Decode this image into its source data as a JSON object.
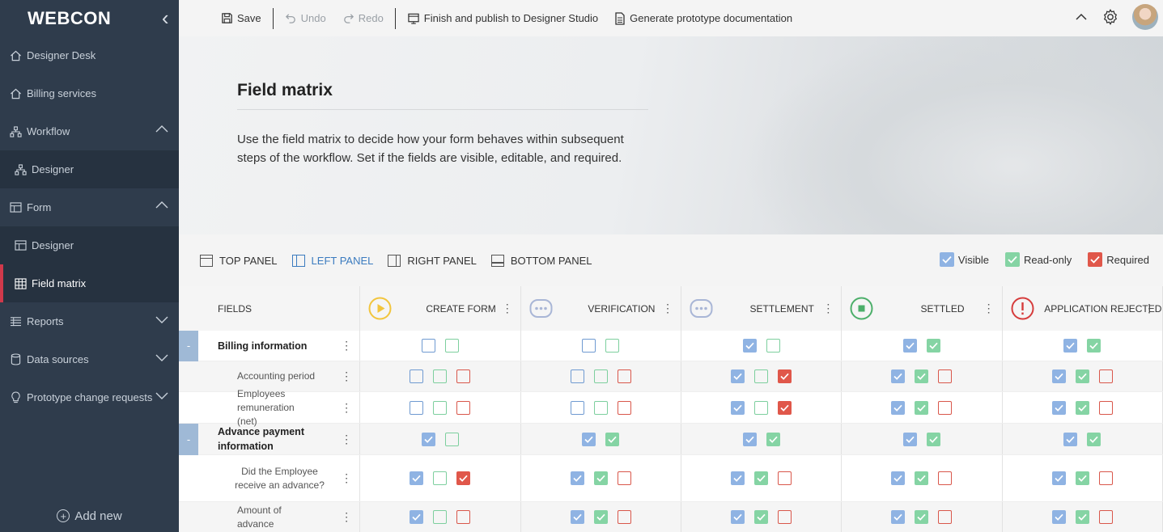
{
  "app": {
    "logo": "WEBCON"
  },
  "sidebar": {
    "items": [
      {
        "label": "Designer Desk",
        "icon": "home-icon"
      },
      {
        "label": "Billing services",
        "icon": "home-icon"
      },
      {
        "label": "Workflow",
        "icon": "workflow-icon",
        "expanded": true
      },
      {
        "label": "Designer",
        "icon": "workflow-icon",
        "sub": true
      },
      {
        "label": "Form",
        "icon": "form-icon",
        "expanded": true
      },
      {
        "label": "Designer",
        "icon": "form-icon",
        "sub": true
      },
      {
        "label": "Field matrix",
        "icon": "matrix-icon",
        "sub": true,
        "active": true
      },
      {
        "label": "Reports",
        "icon": "list-icon",
        "expanded": false
      },
      {
        "label": "Data sources",
        "icon": "database-icon",
        "expanded": false
      },
      {
        "label": "Prototype change requests",
        "icon": "lightbulb-icon",
        "expanded": false
      }
    ],
    "add_new": "Add new"
  },
  "toolbar": {
    "save": "Save",
    "undo": "Undo",
    "redo": "Redo",
    "finish": "Finish and publish to Designer Studio",
    "generate": "Generate prototype documentation"
  },
  "hero": {
    "title": "Field matrix",
    "description": "Use the field matrix to decide how your form behaves within subsequent steps of the workflow. Set if the fields are visible, editable, and required."
  },
  "panels": {
    "tabs": [
      {
        "label": "TOP PANEL",
        "active": false
      },
      {
        "label": "LEFT PANEL",
        "active": true
      },
      {
        "label": "RIGHT PANEL",
        "active": false
      },
      {
        "label": "BOTTOM PANEL",
        "active": false
      }
    ],
    "legend": {
      "visible": "Visible",
      "readonly": "Read-only",
      "required": "Required"
    }
  },
  "colors": {
    "visible": "#8fb3e3",
    "readonly": "#85d4a4",
    "required": "#e0574a",
    "start": "#f2c53d",
    "intermediate": "#a9b6d6",
    "final_ok": "#4caf6a",
    "final_error": "#d63c3c"
  },
  "matrix": {
    "fields_header": "FIELDS",
    "steps": [
      {
        "label": "CREATE FORM",
        "icon": "start-icon"
      },
      {
        "label": "VERIFICATION",
        "icon": "intermediate-step-icon"
      },
      {
        "label": "SETTLEMENT",
        "icon": "intermediate-step-icon"
      },
      {
        "label": "SETTLED",
        "icon": "final-positive-icon"
      },
      {
        "label": "APPLICATION REJECTED",
        "icon": "final-negative-icon"
      }
    ],
    "rows": [
      {
        "label": "Billing information",
        "group": true,
        "cells": [
          [
            0,
            0,
            null
          ],
          [
            0,
            0,
            null
          ],
          [
            1,
            0,
            null
          ],
          [
            1,
            1,
            null
          ],
          [
            1,
            1,
            null
          ]
        ]
      },
      {
        "label": "Accounting period",
        "group": false,
        "cells": [
          [
            0,
            0,
            0
          ],
          [
            0,
            0,
            0
          ],
          [
            1,
            0,
            1
          ],
          [
            1,
            1,
            0
          ],
          [
            1,
            1,
            0
          ]
        ]
      },
      {
        "label": "Employees remuneration (net)",
        "group": false,
        "cells": [
          [
            0,
            0,
            0
          ],
          [
            0,
            0,
            0
          ],
          [
            1,
            0,
            1
          ],
          [
            1,
            1,
            0
          ],
          [
            1,
            1,
            0
          ]
        ]
      },
      {
        "label": "Advance payment information",
        "group": true,
        "cells": [
          [
            1,
            0,
            null
          ],
          [
            1,
            1,
            null
          ],
          [
            1,
            1,
            null
          ],
          [
            1,
            1,
            null
          ],
          [
            1,
            1,
            null
          ]
        ]
      },
      {
        "label": "Did the Employee receive an advance?",
        "group": false,
        "cells": [
          [
            1,
            0,
            1
          ],
          [
            1,
            1,
            0
          ],
          [
            1,
            1,
            0
          ],
          [
            1,
            1,
            0
          ],
          [
            1,
            1,
            0
          ]
        ]
      },
      {
        "label": "Amount of advance",
        "group": false,
        "cells": [
          [
            1,
            0,
            0
          ],
          [
            1,
            1,
            0
          ],
          [
            1,
            1,
            0
          ],
          [
            1,
            1,
            0
          ],
          [
            1,
            1,
            0
          ]
        ]
      }
    ],
    "group_toggle": "-"
  }
}
